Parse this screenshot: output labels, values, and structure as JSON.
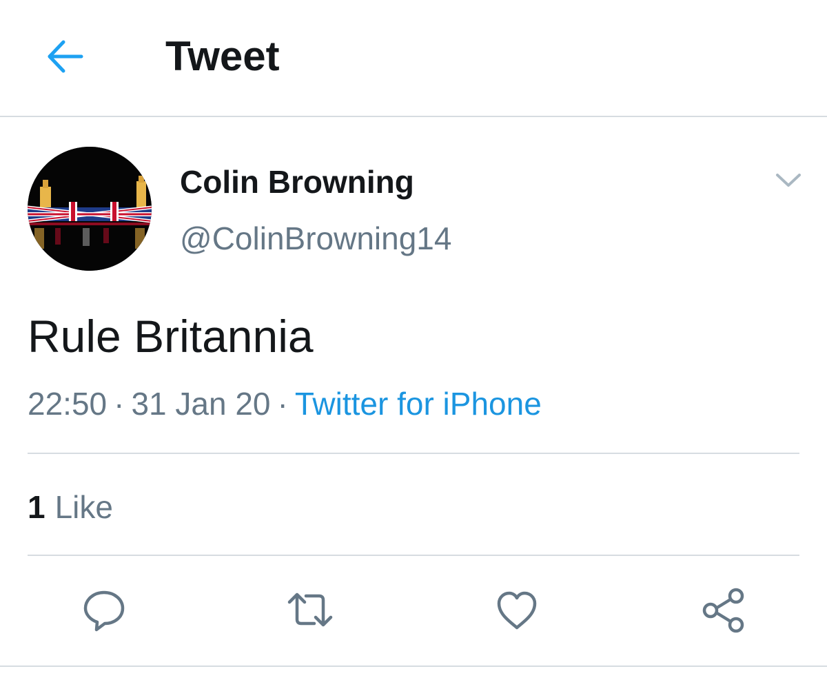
{
  "header": {
    "title": "Tweet",
    "back_icon": "back-arrow-icon"
  },
  "colors": {
    "accent": "#1da1f2",
    "link": "#1b95e0",
    "text_primary": "#14171a",
    "text_secondary": "#657786",
    "divider": "#d6dce1"
  },
  "tweet": {
    "author": {
      "display_name": "Colin Browning",
      "username": "@ColinBrowning14",
      "avatar": "avatar-image"
    },
    "text": "Rule Britannia",
    "time": "22:50",
    "date": "31 Jan 20",
    "separator": "·",
    "source": "Twitter for iPhone",
    "stats": {
      "like_count": "1",
      "like_label": "Like"
    }
  },
  "actions": [
    {
      "name": "reply",
      "icon": "reply-icon"
    },
    {
      "name": "retweet",
      "icon": "retweet-icon"
    },
    {
      "name": "like",
      "icon": "heart-icon"
    },
    {
      "name": "share",
      "icon": "share-icon"
    }
  ]
}
